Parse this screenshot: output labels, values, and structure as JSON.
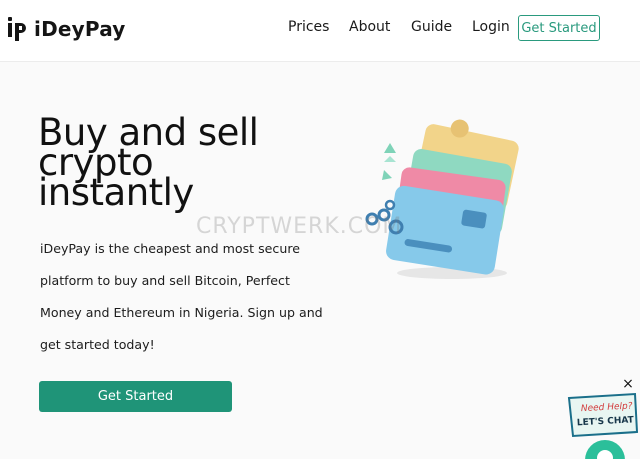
{
  "brand": {
    "name_prefix": "i",
    "name_main": "Dey",
    "name_suffix": "Pay"
  },
  "nav": {
    "prices": "Prices",
    "about": "About",
    "guide": "Guide",
    "login": "Login",
    "cta": "Get Started"
  },
  "hero": {
    "title_line1": "Buy and sell",
    "title_line2": "crypto",
    "title_line3": "instantly",
    "description": "iDeyPay is the cheapest and most secure platform to buy and sell Bitcoin, Perfect Money and Ethereum in Nigeria. Sign up and get started today!",
    "cta": "Get Started"
  },
  "watermark": "CRYPTWERK.COM",
  "chat": {
    "close": "×",
    "line1": "Need Help?",
    "line2": "LET'S CHAT"
  },
  "colors": {
    "accent": "#1f9478",
    "accent_outline": "#2a9a7e",
    "card_blue": "#7ec5e8",
    "card_pink": "#ef8aa6",
    "card_green": "#7fd3b8",
    "card_yellow": "#f2d48a"
  },
  "icons": {
    "logo": "idp-logo-icon",
    "illustration": "wallet-cards-icon",
    "chat": "chat-bubble-icon",
    "close": "close-icon"
  }
}
